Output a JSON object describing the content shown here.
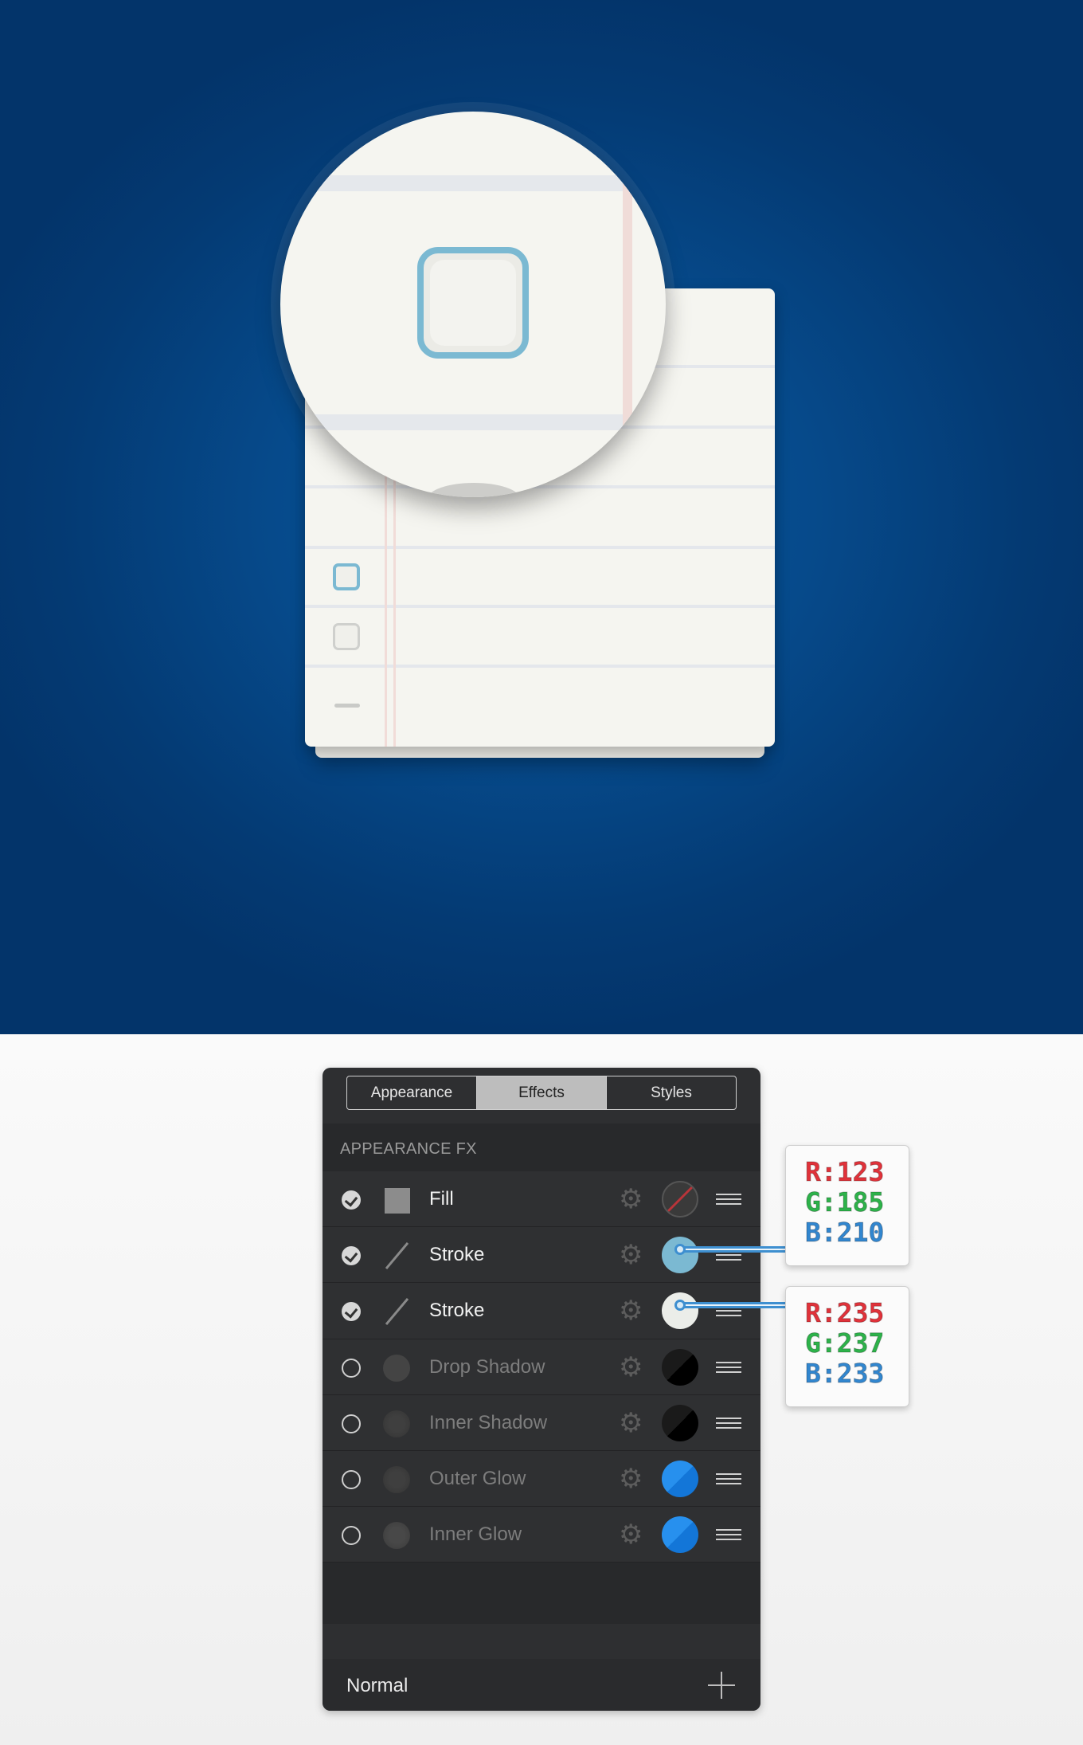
{
  "panel": {
    "tabs": [
      {
        "label": "Appearance",
        "active": false
      },
      {
        "label": "Effects",
        "active": true
      },
      {
        "label": "Styles",
        "active": false
      }
    ],
    "section_title": "APPEARANCE FX",
    "rows": [
      {
        "label": "Fill",
        "enabled": true,
        "icon": "fill-square-icon"
      },
      {
        "label": "Stroke",
        "enabled": true,
        "icon": "stroke-line-icon",
        "color": "#7bb9d2"
      },
      {
        "label": "Stroke",
        "enabled": true,
        "icon": "stroke-line-icon",
        "color": "#ebede9"
      },
      {
        "label": "Drop Shadow",
        "enabled": false,
        "icon": "shadow-dot-icon",
        "color": "#000000"
      },
      {
        "label": "Inner Shadow",
        "enabled": false,
        "icon": "shadow-dot-icon",
        "color": "#000000"
      },
      {
        "label": "Outer Glow",
        "enabled": false,
        "icon": "glow-dot-icon",
        "color": "#1a84e8"
      },
      {
        "label": "Inner Glow",
        "enabled": false,
        "icon": "glow-dot-icon",
        "color": "#1a84e8"
      }
    ],
    "blend_mode": "Normal"
  },
  "callouts": [
    {
      "r": "R:123",
      "g": "G:185",
      "b": "B:210"
    },
    {
      "r": "R:235",
      "g": "G:237",
      "b": "B:233"
    }
  ],
  "colors": {
    "background": "#064a8b",
    "paper": "#f5f5f0",
    "checkbox_stroke": "#7bb9d2",
    "panel": "#2e2f31"
  }
}
